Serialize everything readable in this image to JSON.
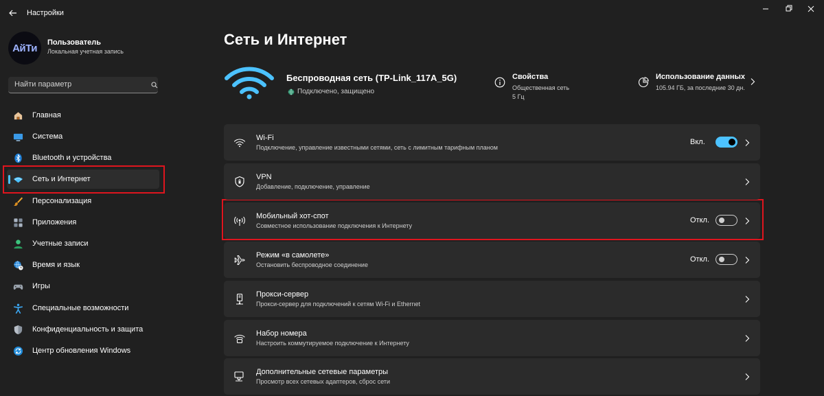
{
  "window": {
    "title": "Настройки"
  },
  "user": {
    "avatar_text": "АйТи",
    "name": "Пользователь",
    "account_type": "Локальная учетная запись"
  },
  "search": {
    "placeholder": "Найти параметр"
  },
  "nav": {
    "items": [
      {
        "label": "Главная",
        "icon": "home-icon",
        "active": false
      },
      {
        "label": "Система",
        "icon": "monitor-icon",
        "active": false
      },
      {
        "label": "Bluetooth и устройства",
        "icon": "bluetooth-icon",
        "active": false
      },
      {
        "label": "Сеть и Интернет",
        "icon": "network-icon",
        "active": true
      },
      {
        "label": "Персонализация",
        "icon": "brush-icon",
        "active": false
      },
      {
        "label": "Приложения",
        "icon": "apps-icon",
        "active": false
      },
      {
        "label": "Учетные записи",
        "icon": "person-icon",
        "active": false
      },
      {
        "label": "Время и язык",
        "icon": "globe-clock-icon",
        "active": false
      },
      {
        "label": "Игры",
        "icon": "gamepad-icon",
        "active": false
      },
      {
        "label": "Специальные возможности",
        "icon": "accessibility-icon",
        "active": false
      },
      {
        "label": "Конфиденциальность и защита",
        "icon": "shield-icon",
        "active": false
      },
      {
        "label": "Центр обновления Windows",
        "icon": "update-icon",
        "active": false
      }
    ]
  },
  "page": {
    "title": "Сеть и Интернет"
  },
  "connection": {
    "name": "Беспроводная сеть (TP-Link_117A_5G)",
    "status": "Подключено, защищено",
    "properties": {
      "title": "Свойства",
      "network_type": "Общественная сеть",
      "band": "5 Гц"
    },
    "usage": {
      "title": "Использование данных",
      "detail": "105.94 ГБ, за последние 30 дн."
    }
  },
  "cards": [
    {
      "title": "Wi-Fi",
      "subtitle": "Подключение, управление известными сетями, сеть с лимитным тарифным планом",
      "icon": "wifi-icon",
      "state_label": "Вкл.",
      "toggle_on": true
    },
    {
      "title": "VPN",
      "subtitle": "Добавление, подключение, управление",
      "icon": "vpn-shield-icon"
    },
    {
      "title": "Мобильный хот-спот",
      "subtitle": "Совместное использование подключения к Интернету",
      "icon": "hotspot-icon",
      "state_label": "Откл.",
      "toggle_on": false
    },
    {
      "title": "Режим «в самолете»",
      "subtitle": "Остановить беспроводное соединение",
      "icon": "airplane-icon",
      "state_label": "Откл.",
      "toggle_on": false
    },
    {
      "title": "Прокси-сервер",
      "subtitle": "Прокси-сервер для подключений к сетям Wi-Fi и Ethernet",
      "icon": "proxy-icon"
    },
    {
      "title": "Набор номера",
      "subtitle": "Настроить коммутируемое подключение к Интернету",
      "icon": "dialup-icon"
    },
    {
      "title": "Дополнительные сетевые параметры",
      "subtitle": "Просмотр всех сетевых адаптеров, сброс сети",
      "icon": "computer-network-icon"
    }
  ],
  "colors": {
    "background": "#202020",
    "card": "#2b2b2b",
    "accent": "#4cc2ff",
    "highlight": "#e0151e"
  }
}
